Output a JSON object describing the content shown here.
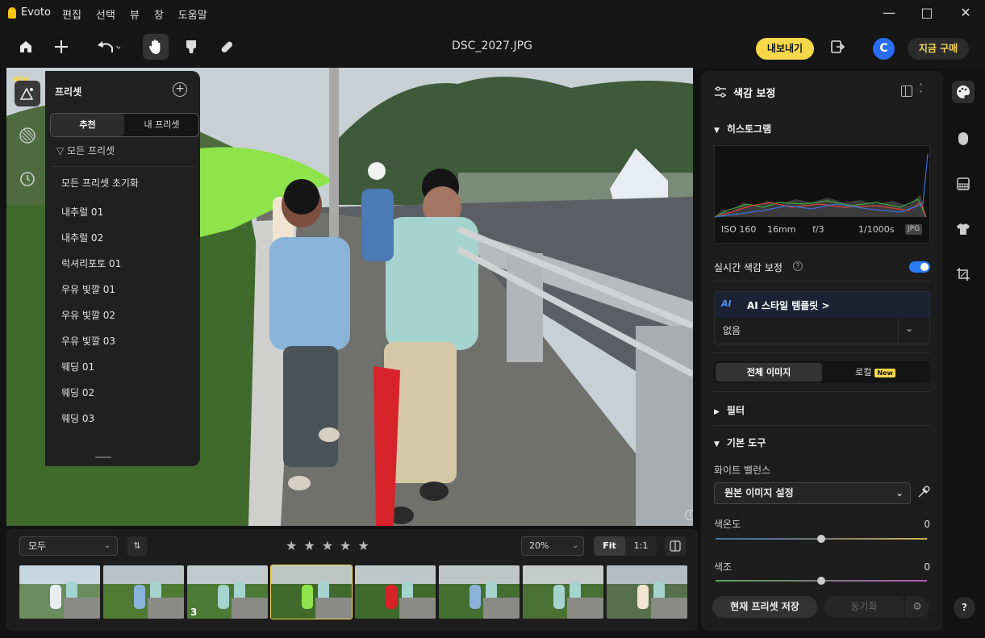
{
  "app": {
    "name": "Evoto"
  },
  "menu": [
    "편집",
    "선택",
    "뷰",
    "창",
    "도움말"
  ],
  "toolbar": {
    "filename": "DSC_2027.JPG",
    "export_label": "내보내기",
    "avatar_letter": "C",
    "buy_label": "지금 구매"
  },
  "left_rail": {
    "new_tag": "NEW"
  },
  "presets": {
    "title": "프리셋",
    "tabs": [
      "추천",
      "내 프리셋"
    ],
    "active_tab": 0,
    "filter_label": "모든 프리셋",
    "items": [
      "모든 프리셋 초기화",
      "내추럴 01",
      "내추럴 02",
      "럭셔리포토 01",
      "우유 빛깔 01",
      "우유 빛깔 02",
      "우유 빛깔 03",
      "웨딩 01",
      "웨딩 02",
      "웨딩 03"
    ]
  },
  "right_panel": {
    "title": "색감 보정",
    "histogram": {
      "label": "히스토그램",
      "iso": "ISO 160",
      "focal": "16mm",
      "aperture": "f/3",
      "shutter": "1/1000s",
      "format": "JPG"
    },
    "realtime_label": "실시간 색감 보정",
    "realtime_on": true,
    "ai_template": {
      "label": "AI 스타일 템플릿 >",
      "ai_badge": "AI",
      "value": "없음"
    },
    "scope_tabs": [
      "전체 이미지",
      "로컬"
    ],
    "new_badge": "New",
    "filter_section": "필터",
    "basic_section": "기본 도구",
    "white_balance": {
      "label": "화이트 밸런스",
      "value": "원본 이미지 설정"
    },
    "sliders": [
      {
        "label": "색온도",
        "value": "0",
        "position": 0.5
      },
      {
        "label": "색조",
        "value": "0",
        "position": 0.5
      }
    ],
    "save_preset": "현재 프리셋 저장",
    "sync": "동기화",
    "help": "?"
  },
  "filmstrip": {
    "filter_value": "모두",
    "zoom_value": "20%",
    "fit_options": [
      "Fit",
      "1:1"
    ],
    "active_fit": 0,
    "star_count": 5,
    "thumbnails": [
      {
        "badge": ""
      },
      {
        "badge": ""
      },
      {
        "badge": "3"
      },
      {
        "badge": "",
        "selected": true
      },
      {
        "badge": ""
      },
      {
        "badge": ""
      },
      {
        "badge": ""
      },
      {
        "badge": ""
      }
    ]
  },
  "colors": {
    "accent_yellow": "#f6d84a",
    "accent_blue": "#2a7ef5",
    "panel": "#1d1d1d",
    "background": "#121212"
  }
}
